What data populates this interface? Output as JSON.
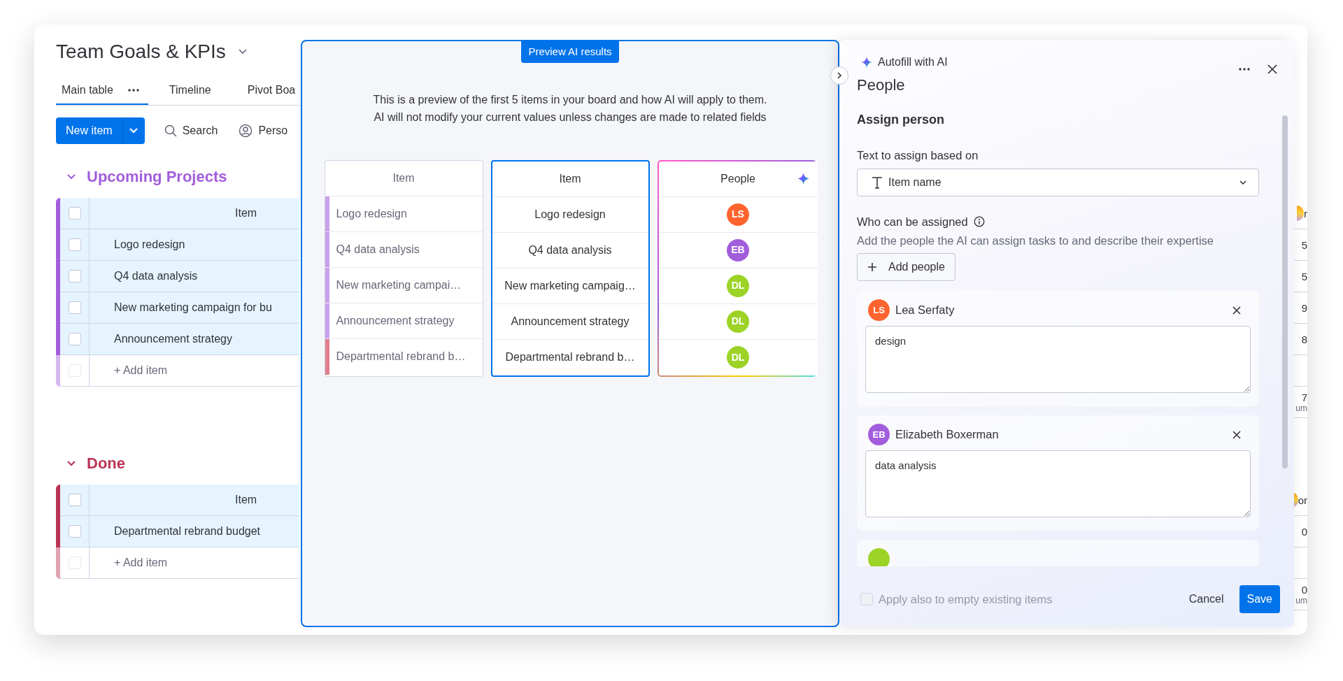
{
  "board": {
    "title": "Team Goals & KPIs",
    "tabs": [
      {
        "label": "Main table",
        "selected": true
      },
      {
        "label": "Timeline",
        "selected": false
      },
      {
        "label": "Pivot Boa",
        "selected": false
      }
    ],
    "toolbar": {
      "new_item": "New item",
      "search": "Search",
      "person": "Perso"
    },
    "groups": [
      {
        "title": "Upcoming Projects",
        "color": "#a25ddc",
        "header": "Item",
        "header_checked": false,
        "add_checked": false,
        "header_cut_column": "r",
        "rows": [
          {
            "text": "Logo redesign",
            "checked": false,
            "cut_column": "5"
          },
          {
            "text": "Q4 data analysis",
            "checked": false,
            "cut_column": "5"
          },
          {
            "text": "New marketing campaign for bu",
            "checked": false,
            "cut_column": "9"
          },
          {
            "text": "Announcement strategy",
            "checked": false,
            "cut_column": "8"
          }
        ],
        "add_item": "+ Add item",
        "summary_cut_column": [
          "7",
          "um"
        ]
      },
      {
        "title": "Done",
        "color": "#bb3354",
        "header": "Item",
        "header_checked": false,
        "add_checked": false,
        "header_cut_column": "or",
        "rows": [
          {
            "text": "Departmental rebrand budget",
            "checked": false,
            "cut_column": "0"
          }
        ],
        "add_item": "+ Add item",
        "summary_cut_column": [
          "0",
          "um"
        ]
      }
    ]
  },
  "preview": {
    "badge": "Preview AI results",
    "description": [
      "This is a preview of the first 5 items in your board and how AI will apply to them.",
      "AI will not modify your current values unless changes are made to related fields"
    ],
    "tables": [
      {
        "kind": "source",
        "header": "Item",
        "rows": [
          {
            "text": "Logo redesign",
            "color": "#c9a0ea"
          },
          {
            "text": "Q4 data analysis",
            "color": "#c9a0ea"
          },
          {
            "text": "New marketing campai…",
            "color": "#c9a0ea"
          },
          {
            "text": "Announcement strategy",
            "color": "#c9a0ea"
          },
          {
            "text": "Departmental rebrand b…",
            "color": "#df7f8e"
          }
        ]
      },
      {
        "kind": "result",
        "header": "Item",
        "rows": [
          {
            "text": "Logo redesign"
          },
          {
            "text": "Q4 data analysis"
          },
          {
            "text": "New marketing campaig…"
          },
          {
            "text": "Announcement strategy"
          },
          {
            "text": "Departmental rebrand b…"
          }
        ]
      },
      {
        "kind": "people",
        "header": "People",
        "rows": [
          {
            "initials": "LS",
            "color": "#ff642e"
          },
          {
            "initials": "EB",
            "color": "#a25ddc"
          },
          {
            "initials": "DL",
            "color": "#9cd326"
          },
          {
            "initials": "DL",
            "color": "#9cd326"
          },
          {
            "initials": "DL",
            "color": "#9cd326"
          }
        ]
      }
    ]
  },
  "panel": {
    "eyebrow": "Autofill with AI",
    "title": "People",
    "section": "Assign person",
    "source_label": "Text to assign based on",
    "source_value": "Item name",
    "assignees_label": "Who can be assigned",
    "assignees_hint": "Add the people the AI can assign tasks to and describe their expertise",
    "add_button": "Add people",
    "people": [
      {
        "initials": "LS",
        "name": "Lea Serfaty",
        "color": "#ff642e",
        "expertise": "design"
      },
      {
        "initials": "EB",
        "name": "Elizabeth Boxerman",
        "color": "#a25ddc",
        "expertise": "data analysis"
      },
      {
        "color": "#9cd326"
      }
    ],
    "apply_empty": {
      "label": "Apply also to empty existing items",
      "checked": false,
      "disabled": true
    },
    "cancel": "Cancel",
    "save": "Save"
  }
}
